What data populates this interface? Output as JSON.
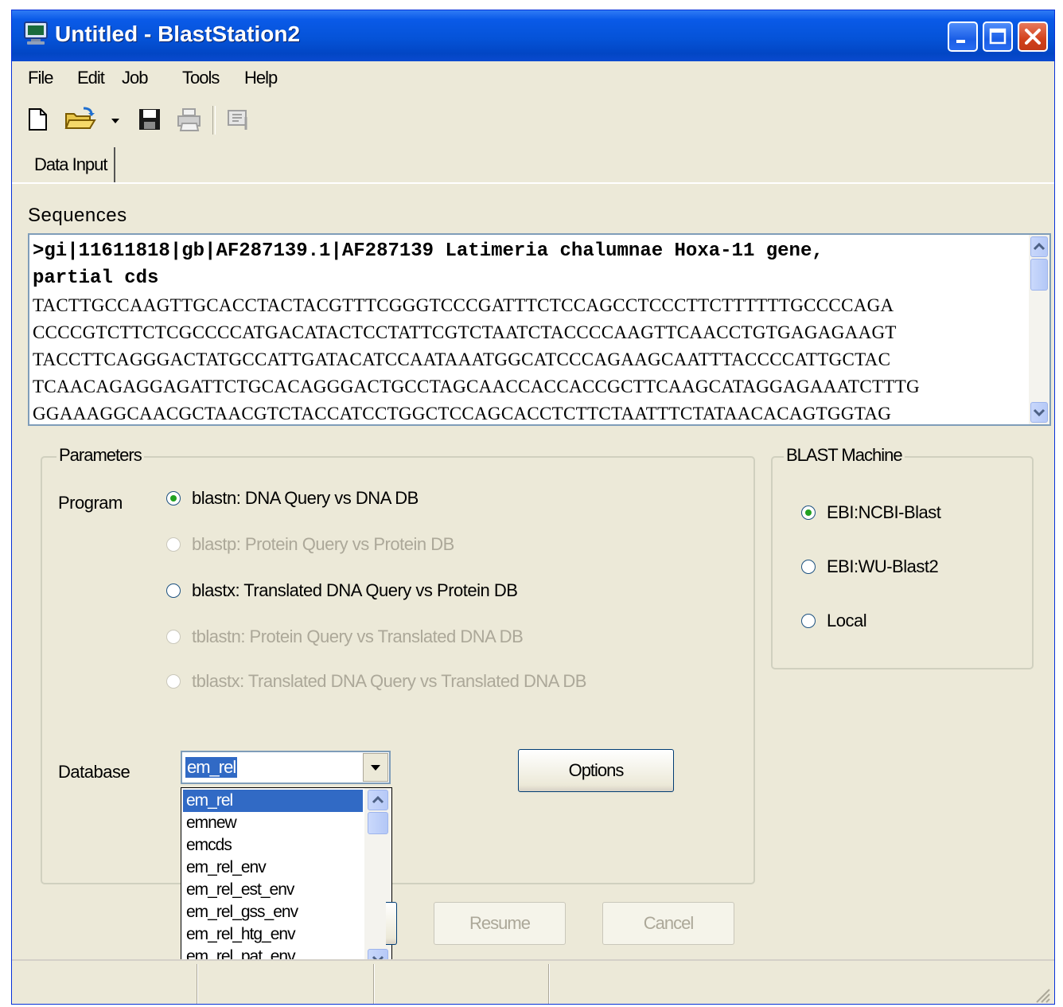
{
  "window": {
    "title": "Untitled - BlastStation2",
    "title_bar_color": "#0553d8",
    "window_bg": "#ece9d8"
  },
  "menu": [
    "File",
    "Edit",
    "Job",
    "Tools",
    "Help"
  ],
  "toolbar": {
    "icons": [
      "new-file-icon",
      "open-folder-icon",
      "dropdown-arrow-icon",
      "save-icon",
      "print-icon",
      "run-icon"
    ]
  },
  "tabs": [
    "Data Input"
  ],
  "sequences": {
    "label": "Sequences",
    "header_line1": ">gi|11611818|gb|AF287139.1|AF287139 Latimeria chalumnae Hoxa-11 gene,",
    "header_line2": "partial cds",
    "lines": [
      "TACTTGCCAAGTTGCACCTACTACGTTTCGGGTCCCGATTTCTCCAGCCTCCCTTCTTTTTTGCCCCAGA",
      "CCCCGTCTTCTCGCCCCATGACATACTCCTATTCGTCTAATCTACCCCAAGTTCAACCTGTGAGAGAAGT",
      "TACCTTCAGGGACTATGCCATTGATACATCCAATAAATGGCATCCCAGAAGCAATTTACCCCATTGCTAC",
      "TCAACAGAGGAGATTCTGCACAGGGACTGCCTAGCAACCACCACCGCTTCAAGCATAGGAGAAATCTTTG",
      "GGAAAGGCAACGCTAACGTCTACCATCCTGGCTCCAGCACCTCTTCTAATTTCTATAACACAGTGGTAG"
    ]
  },
  "parameters": {
    "label": "Parameters",
    "program_label": "Program",
    "programs": [
      {
        "label": "blastn: DNA Query vs DNA DB",
        "selected": true,
        "enabled": true
      },
      {
        "label": "blastp: Protein Query vs Protein DB",
        "selected": false,
        "enabled": false
      },
      {
        "label": "blastx: Translated DNA Query vs Protein DB",
        "selected": false,
        "enabled": true
      },
      {
        "label": "tblastn: Protein Query vs Translated DNA DB",
        "selected": false,
        "enabled": false
      },
      {
        "label": "tblastx: Translated DNA Query vs Translated DNA DB",
        "selected": false,
        "enabled": false
      }
    ],
    "database_label": "Database",
    "database_value": "em_rel",
    "database_options": [
      "em_rel",
      "emnew",
      "emcds",
      "em_rel_env",
      "em_rel_est_env",
      "em_rel_gss_env",
      "em_rel_htg_env",
      "em_rel_pat_env"
    ],
    "options_button": "Options"
  },
  "blast_machine": {
    "label": "BLAST Machine",
    "options": [
      {
        "label": "EBI:NCBI-Blast",
        "selected": true
      },
      {
        "label": "EBI:WU-Blast2",
        "selected": false
      },
      {
        "label": "Local",
        "selected": false
      }
    ]
  },
  "actions": {
    "resume": "Resume",
    "cancel": "Cancel"
  },
  "colors": {
    "selection": "#316ac5",
    "radio_dot": "#21a121",
    "disabled_text": "#aca899"
  }
}
